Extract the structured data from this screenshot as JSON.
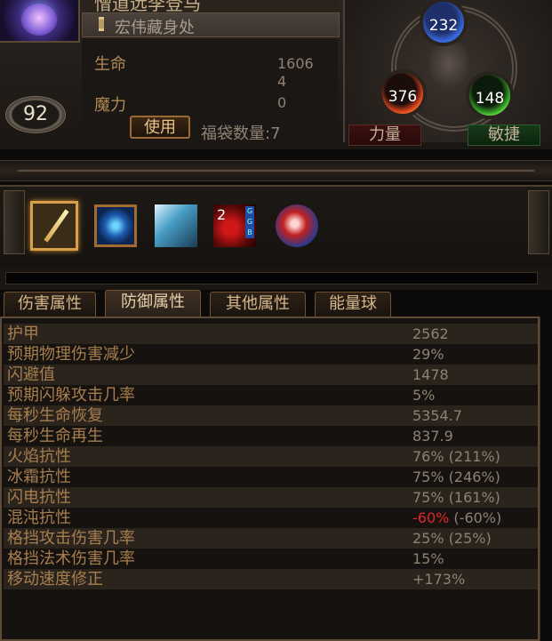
{
  "character": {
    "name": "憎道远李登马",
    "location": "宏伟藏身处",
    "level": "92"
  },
  "stats": {
    "life_label": "生命",
    "life_value": "1606",
    "extra_value": "4",
    "mana_label": "魔力",
    "mana_value": "0"
  },
  "actions": {
    "use_label": "使用",
    "bag_count": "福袋数量:7"
  },
  "attributes": {
    "intelligence": "232",
    "strength": "376",
    "dexterity": "148",
    "strength_label": "力量",
    "dexterity_label": "敏捷"
  },
  "skill_bar": {
    "slot4_count": "2",
    "slot4_gems": "G G B"
  },
  "tabs": [
    {
      "label": "伤害属性"
    },
    {
      "label": "防御属性"
    },
    {
      "label": "其他属性"
    },
    {
      "label": "能量球"
    }
  ],
  "defense_stats": [
    {
      "label": "护甲",
      "value": "2562"
    },
    {
      "label": "预期物理伤害减少",
      "value": "29%"
    },
    {
      "label": "闪避值",
      "value": "1478"
    },
    {
      "label": "预期闪躲攻击几率",
      "value": "5%"
    },
    {
      "label": "每秒生命恢复",
      "value": "5354.7"
    },
    {
      "label": "每秒生命再生",
      "value": "837.9"
    },
    {
      "label": "火焰抗性",
      "value": "76% (211%)"
    },
    {
      "label": "冰霜抗性",
      "value": "75% (246%)"
    },
    {
      "label": "闪电抗性",
      "value": "75% (161%)"
    },
    {
      "label": "混沌抗性",
      "value": "-60%",
      "value_suffix": " (-60%)"
    },
    {
      "label": "格挡攻击伤害几率",
      "value": "25% (25%)"
    },
    {
      "label": "格挡法术伤害几率",
      "value": "15%"
    },
    {
      "label": "移动速度修正",
      "value": "+173%"
    }
  ],
  "colors": {
    "label": "#a77e4e",
    "value": "#8e8173",
    "negative": "#e0262a",
    "accent": "#d8a04b"
  }
}
